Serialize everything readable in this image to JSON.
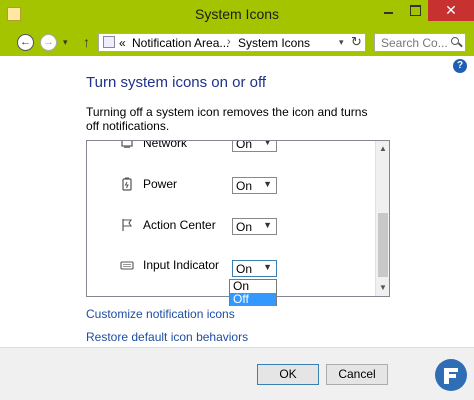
{
  "window": {
    "title": "System Icons",
    "close_glyph": "✕"
  },
  "address": {
    "back_glyph": "←",
    "forward_glyph": "→",
    "recent_glyph": "▾",
    "up_glyph": "↑",
    "chevron": "«",
    "crumbs": [
      "Notification Area...",
      "System Icons"
    ],
    "separator": "›",
    "dropdown_glyph": "▾",
    "refresh_glyph": "↻",
    "search_placeholder": "Search Co..."
  },
  "content": {
    "help_glyph": "?",
    "heading": "Turn system icons on or off",
    "description": "Turning off a system icon removes the icon and turns off notifications.",
    "rows": [
      {
        "label": "Network",
        "value": "On",
        "icon": "network-icon"
      },
      {
        "label": "Power",
        "value": "On",
        "icon": "power-icon"
      },
      {
        "label": "Action Center",
        "value": "On",
        "icon": "flag-icon"
      },
      {
        "label": "Input Indicator",
        "value": "On",
        "icon": "keyboard-icon"
      }
    ],
    "dropdown_options": [
      "On",
      "Off"
    ],
    "dropdown_highlighted": "Off",
    "links": [
      "Customize notification icons",
      "Restore default icon behaviors"
    ]
  },
  "footer": {
    "ok_label": "OK",
    "cancel_label": "Cancel"
  },
  "colors": {
    "frame": "#a4c400",
    "heading": "#1e3287",
    "link": "#1e4ea3",
    "highlight": "#3399ff",
    "close": "#c7312f"
  }
}
